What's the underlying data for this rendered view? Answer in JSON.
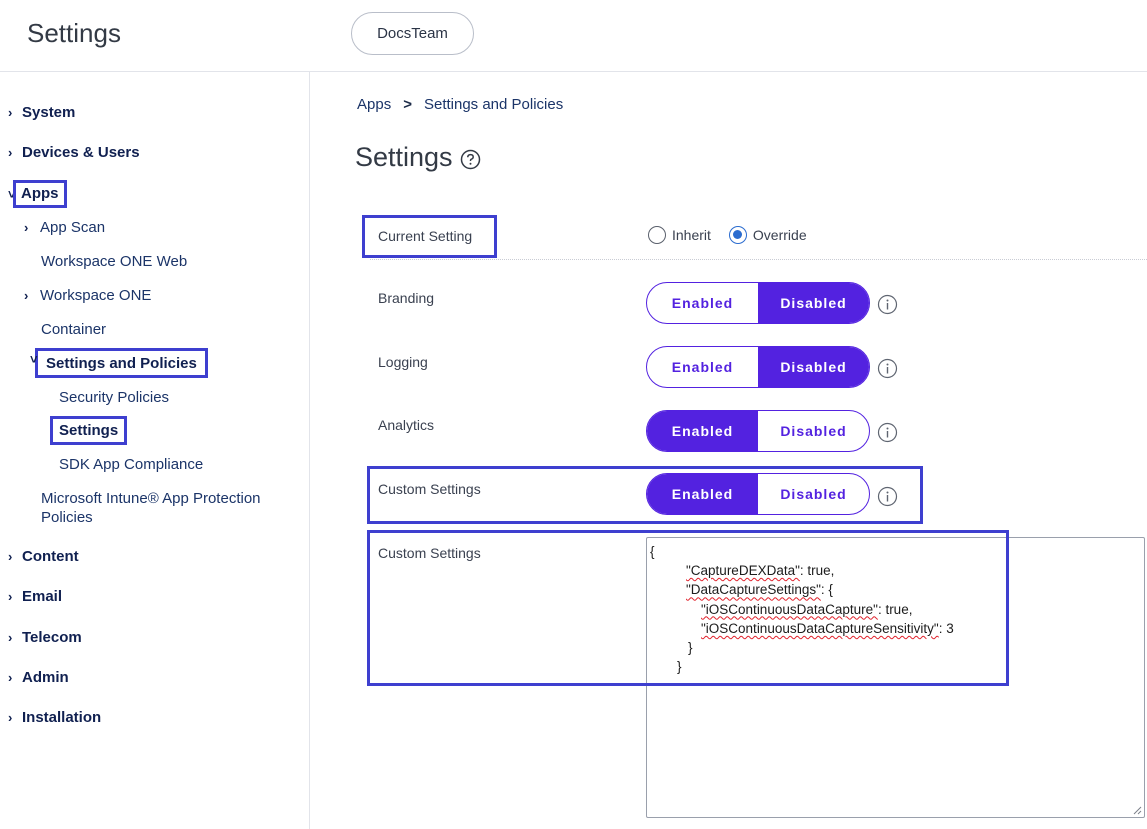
{
  "header": {
    "title": "Settings",
    "org_name": "DocsTeam"
  },
  "sidebar": {
    "system": "System",
    "devices_users": "Devices & Users",
    "apps": "Apps",
    "app_scan": "App Scan",
    "workspace_one_web": "Workspace ONE Web",
    "workspace_one": "Workspace ONE",
    "container": "Container",
    "settings_and_policies": "Settings and Policies",
    "security_policies": "Security Policies",
    "settings": "Settings",
    "sdk_app_compliance": "SDK App Compliance",
    "intune_line1": "Microsoft Intune® App Protection",
    "intune_line2": "Policies",
    "content": "Content",
    "email": "Email",
    "telecom": "Telecom",
    "admin": "Admin",
    "installation": "Installation"
  },
  "breadcrumb": {
    "root": "Apps",
    "current": "Settings and Policies"
  },
  "page": {
    "title": "Settings"
  },
  "current_setting": {
    "label": "Current Setting",
    "inherit_label": "Inherit",
    "override_label": "Override",
    "selected": "Override"
  },
  "toggles": {
    "enabled_label": "Enabled",
    "disabled_label": "Disabled",
    "branding": {
      "label": "Branding",
      "state": "Disabled"
    },
    "logging": {
      "label": "Logging",
      "state": "Disabled"
    },
    "analytics": {
      "label": "Analytics",
      "state": "Enabled"
    },
    "custom_settings": {
      "label": "Custom Settings",
      "state": "Enabled"
    }
  },
  "custom_settings_field": {
    "label": "Custom Settings",
    "lines": {
      "l1": "{",
      "l2_key": "\"CaptureDEXData\"",
      "l2_rest": ": true,",
      "l3_key": "\"DataCaptureSettings\"",
      "l3_rest": ": {",
      "l4_key": "\"iOSContinuousDataCapture\"",
      "l4_rest": ": true,",
      "l5_key": "\"iOSContinuousDataCaptureSensitivity\"",
      "l5_rest": ": 3",
      "l6": "}",
      "l7": "}"
    }
  },
  "colors": {
    "accent": "#5322e0",
    "highlight_box": "#3e3fcf",
    "nav_text": "#102050",
    "radio_selected": "#2b6ccf"
  }
}
